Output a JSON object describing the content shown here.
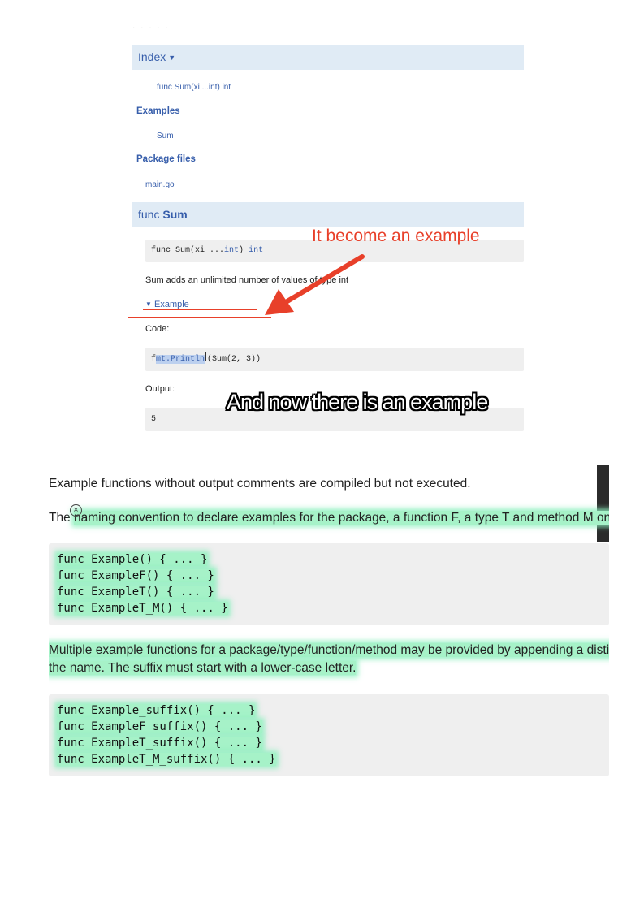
{
  "godoc": {
    "cut_text": "· · · · ·",
    "index_title": "Index",
    "index_items": [
      "func Sum(xi ...int) int"
    ],
    "examples_heading": "Examples",
    "example_items": [
      "Sum"
    ],
    "package_files_heading": "Package files",
    "package_files": [
      "main.go"
    ],
    "func_prefix": "func",
    "func_name": "Sum",
    "signature_prefix": "func Sum(xi ...",
    "signature_type": "int",
    "signature_close": ")",
    "signature_return": "int",
    "description": "Sum adds an unlimited number of values of type int",
    "example_toggle": "Example",
    "code_label": "Code:",
    "code_f": "f",
    "code_selected": "mt.Println",
    "code_rest": "(Sum(2, 3))",
    "output_label": "Output:",
    "output_value": "5",
    "caption": "And now there is an example"
  },
  "annotation": {
    "label": "It become an example",
    "color": "#e8402a"
  },
  "doc": {
    "para1": "Example functions without output comments are compiled but not executed.",
    "para2_start": "The ",
    "para2_hl": "naming convention to declare examples for the package, a function F, a type T and method M on type T are:",
    "code1": [
      "func Example() { ... }",
      "func ExampleF() { ... }",
      "func ExampleT() { ... }",
      "func ExampleT_M() { ... }"
    ],
    "para3_line1": "Multiple example functions for a package/type/function/method may be provided by appending a distinct suffix to",
    "para3_line2": "the name. The suffix must start with a lower-case letter.",
    "code2": [
      "func Example_suffix() { ... }",
      "func ExampleF_suffix() { ... }",
      "func ExampleT_suffix() { ... }",
      "func ExampleT_M_suffix() { ... }"
    ]
  },
  "colors": {
    "godoc_blue": "#375eab",
    "section_bar": "#e0ebf5",
    "highlight": "#a6f2c8"
  }
}
